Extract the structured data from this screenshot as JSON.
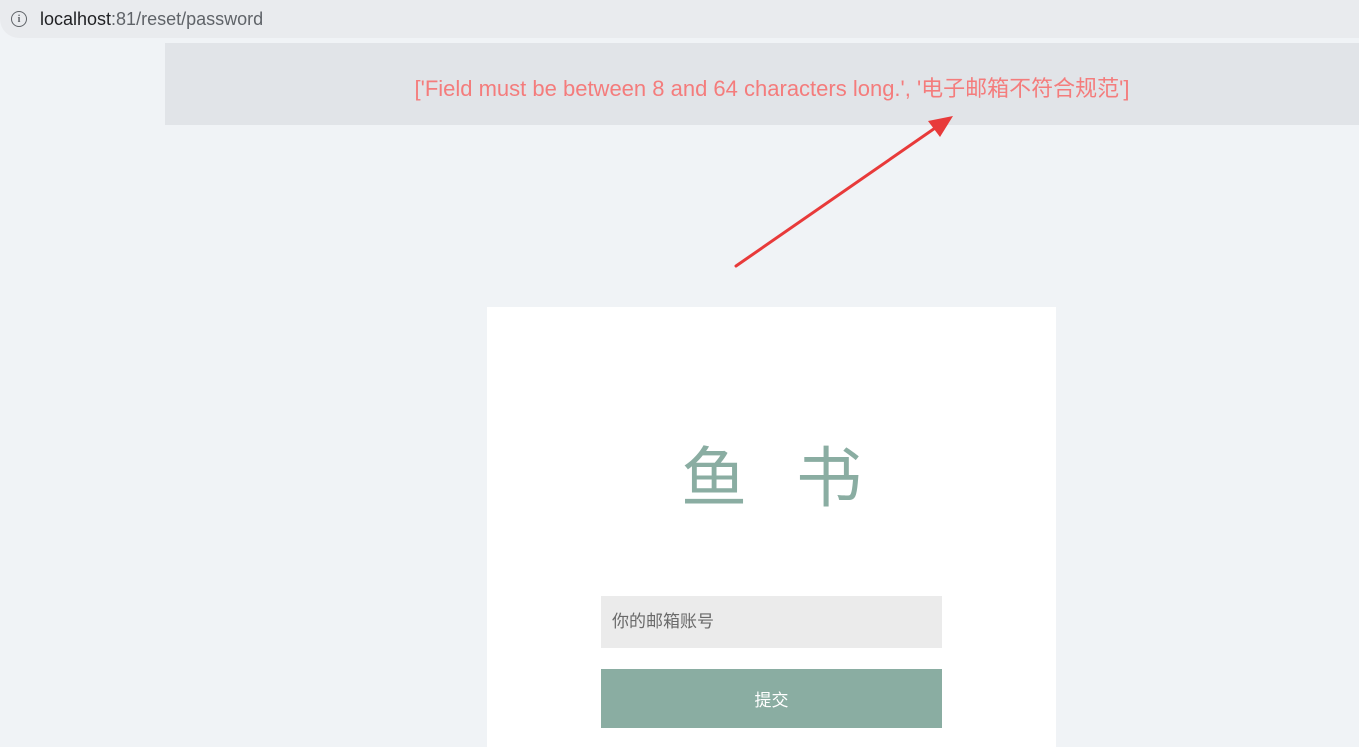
{
  "browser": {
    "url_host": "localhost",
    "url_rest": ":81/reset/password",
    "info_icon": "info-icon"
  },
  "flash": {
    "message": "['Field must be between 8 and 64 characters long.', '电子邮箱不符合规范']",
    "color": "#f47c7c"
  },
  "annotation": {
    "arrow_color": "#e83a3a"
  },
  "card": {
    "title": "鱼 书",
    "email_placeholder": "你的邮箱账号",
    "email_value": "",
    "submit_label": "提交",
    "accent_color": "#8aada2"
  }
}
